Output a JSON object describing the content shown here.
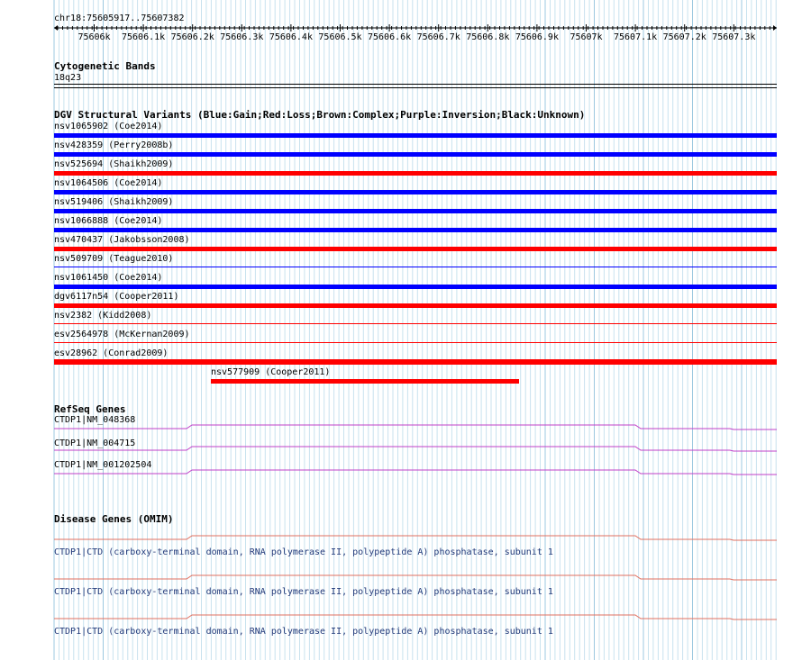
{
  "header": {
    "location": "chr18:75605917..75607382"
  },
  "ruler": {
    "ticks": [
      "75606k",
      "75606.1k",
      "75606.2k",
      "75606.3k",
      "75606.4k",
      "75606.5k",
      "75606.6k",
      "75606.7k",
      "75606.8k",
      "75606.9k",
      "75607k",
      "75607.1k",
      "75607.2k",
      "75607.3k"
    ]
  },
  "cytoband": {
    "title": "Cytogenetic Bands",
    "band": "18q23"
  },
  "dgv": {
    "title": "DGV Structural Variants (Blue:Gain;Red:Loss;Brown:Complex;Purple:Inversion;Black:Unknown)",
    "colors": {
      "gain": "#0000ff",
      "loss": "#ff0000"
    },
    "variants": [
      {
        "label": "nsv1065902 (Coe2014)",
        "type": "gain"
      },
      {
        "label": "nsv428359 (Perry2008b)",
        "type": "gain"
      },
      {
        "label": "nsv525694 (Shaikh2009)",
        "type": "loss"
      },
      {
        "label": "nsv1064506 (Coe2014)",
        "type": "gain"
      },
      {
        "label": "nsv519406 (Shaikh2009)",
        "type": "gain"
      },
      {
        "label": "nsv1066888 (Coe2014)",
        "type": "gain"
      },
      {
        "label": "nsv470437 (Jakobsson2008)",
        "type": "loss"
      },
      {
        "label": "nsv509709 (Teague2010)",
        "type": "gain"
      },
      {
        "label": "nsv1061450 (Coe2014)",
        "type": "gain"
      },
      {
        "label": "dgv6117n54 (Cooper2011)",
        "type": "loss"
      },
      {
        "label": "nsv2382 (Kidd2008)",
        "type": "loss"
      },
      {
        "label": "esv2564978 (McKernan2009)",
        "type": "loss"
      },
      {
        "label": "esv28962 (Conrad2009)",
        "type": "loss"
      },
      {
        "label": "nsv577909 (Cooper2011)",
        "type": "loss"
      }
    ]
  },
  "refseq": {
    "title": "RefSeq Genes",
    "color": "#c040c8",
    "genes": [
      {
        "label": "CTDP1|NM_048368"
      },
      {
        "label": "CTDP1|NM_004715"
      },
      {
        "label": "CTDP1|NM_001202504"
      }
    ]
  },
  "omim": {
    "title": "Disease Genes (OMIM)",
    "color": "#e07060",
    "genes": [
      {
        "label": "CTDP1|CTD (carboxy-terminal domain, RNA polymerase II, polypeptide A) phosphatase, subunit 1"
      },
      {
        "label": "CTDP1|CTD (carboxy-terminal domain, RNA polymerase II, polypeptide A) phosphatase, subunit 1"
      },
      {
        "label": "CTDP1|CTD (carboxy-terminal domain, RNA polymerase II, polypeptide A) phosphatase, subunit 1"
      }
    ]
  }
}
